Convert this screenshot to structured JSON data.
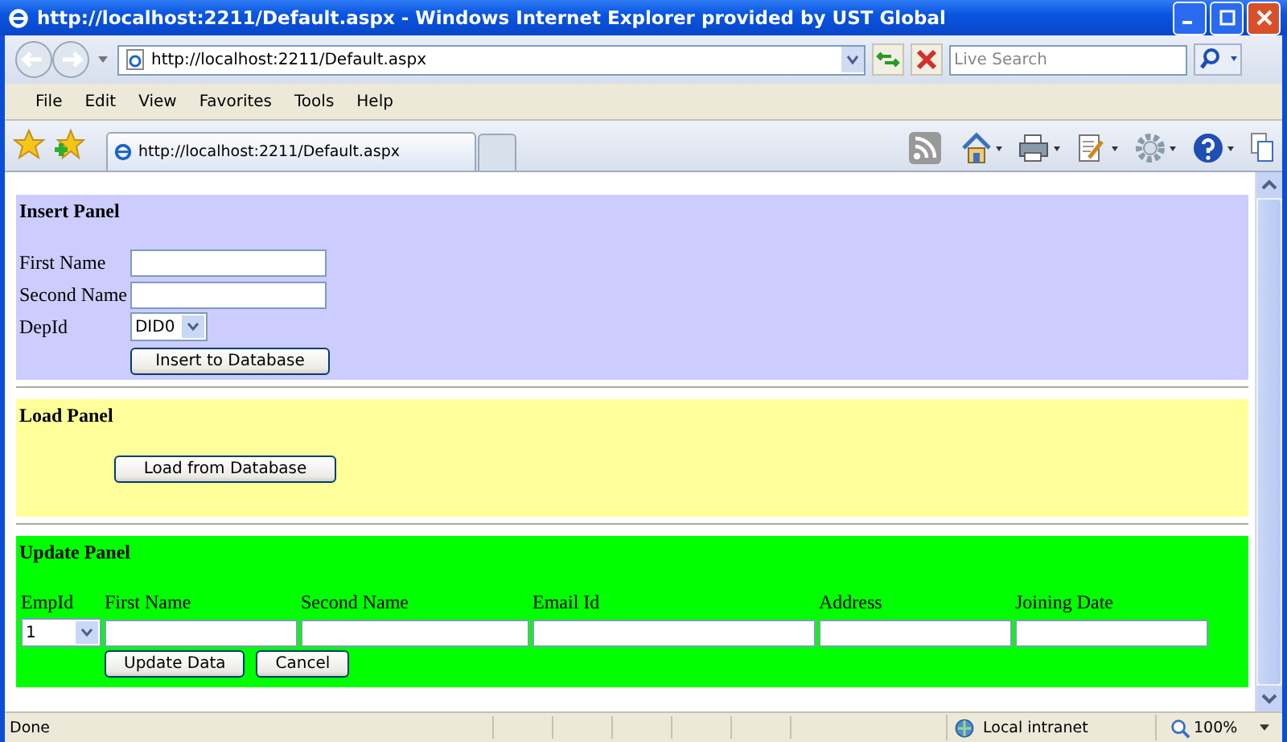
{
  "window": {
    "title": "http://localhost:2211/Default.aspx - Windows Internet Explorer provided by UST Global"
  },
  "address_bar": {
    "url": "http://localhost:2211/Default.aspx"
  },
  "search": {
    "placeholder": "Live Search"
  },
  "menu": [
    "File",
    "Edit",
    "View",
    "Favorites",
    "Tools",
    "Help"
  ],
  "tabs": [
    {
      "title": "http://localhost:2211/Default.aspx",
      "selected": true
    }
  ],
  "insert_panel": {
    "title": "Insert Panel",
    "fields": [
      {
        "label": "First Name"
      },
      {
        "label": "Second Name"
      }
    ],
    "dep": {
      "label": "DepId",
      "value": "DID0"
    },
    "button": "Insert to Database"
  },
  "load_panel": {
    "title": "Load Panel",
    "button": "Load from Database"
  },
  "update_panel": {
    "title": "Update Panel",
    "empid": {
      "label": "EmpId",
      "value": "1"
    },
    "columns": [
      "First Name",
      "Second Name",
      "Email Id",
      "Address",
      "Joining Date"
    ],
    "buttons": [
      "Update Data",
      "Cancel"
    ]
  },
  "status_bar": {
    "text": "Done",
    "zone": "Local intranet",
    "zoom": "100%"
  }
}
